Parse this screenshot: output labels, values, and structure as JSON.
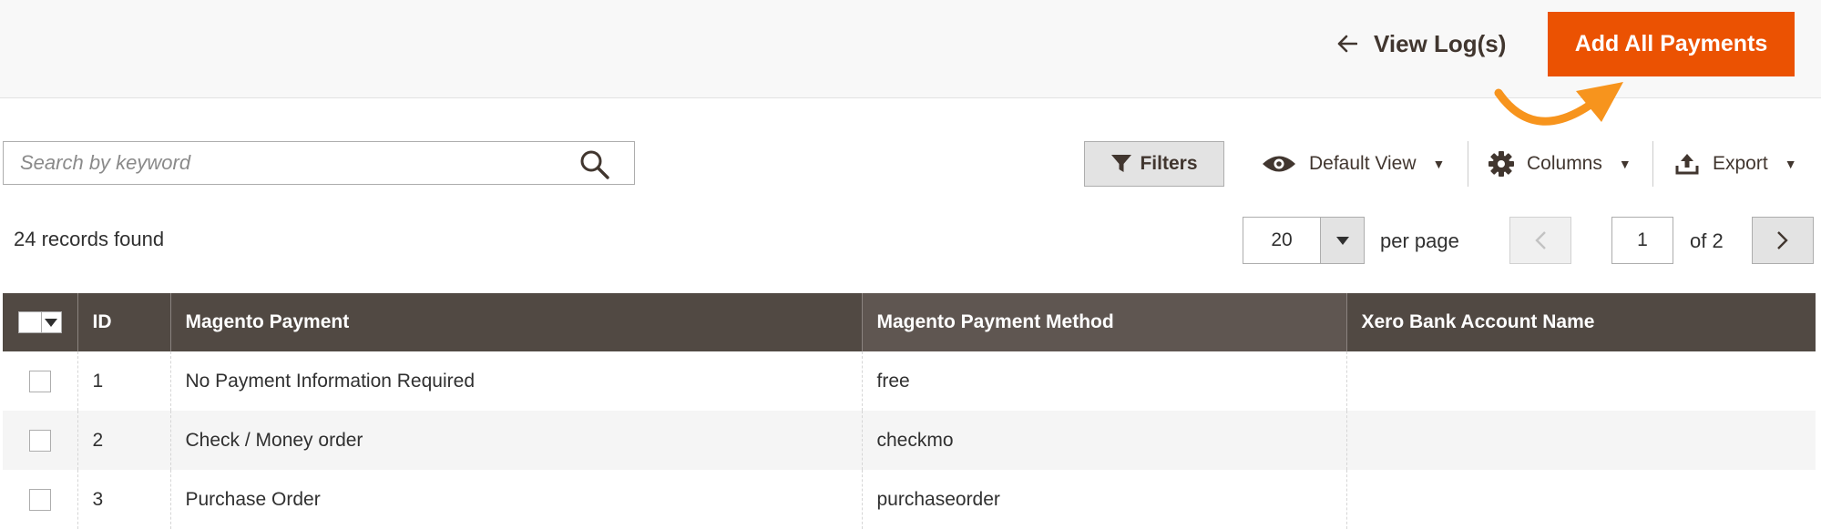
{
  "header": {
    "view_logs_label": "View Log(s)",
    "add_all_label": "Add All Payments",
    "accent_color": "#eb5202",
    "annotation_arrow_color": "#f7941d"
  },
  "toolbar": {
    "search_placeholder": "Search by keyword",
    "filters_label": "Filters",
    "view_label": "Default View",
    "columns_label": "Columns",
    "export_label": "Export"
  },
  "records_found": "24 records found",
  "pagination": {
    "per_page_value": "20",
    "per_page_label": "per page",
    "current_page": "1",
    "of_pages": "of 2"
  },
  "table": {
    "columns": [
      "ID",
      "Magento Payment",
      "Magento Payment Method",
      "Xero Bank Account Name"
    ],
    "rows": [
      {
        "id": "1",
        "payment": "No Payment Information Required",
        "method": "free",
        "account": ""
      },
      {
        "id": "2",
        "payment": "Check / Money order",
        "method": "checkmo",
        "account": ""
      },
      {
        "id": "3",
        "payment": "Purchase Order",
        "method": "purchaseorder",
        "account": ""
      }
    ]
  },
  "header_bg_color": "#514943"
}
